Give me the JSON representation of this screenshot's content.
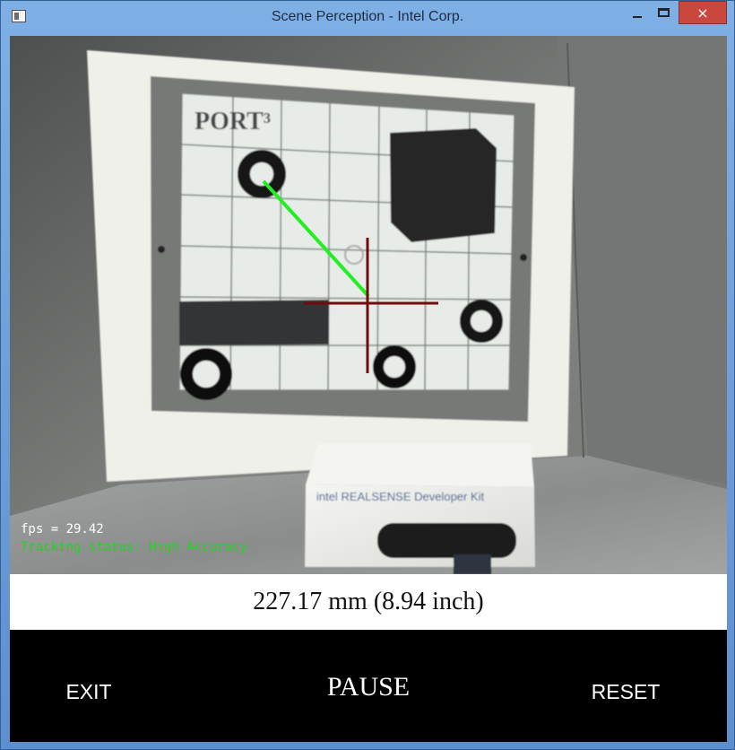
{
  "window": {
    "title": "Scene Perception - Intel Corp.",
    "icons": {
      "app": "app-window-icon",
      "minimize": "minimize-icon",
      "maximize": "maximize-icon",
      "close": "close-icon"
    },
    "close_label": "×"
  },
  "camera_view": {
    "fps_text": "fps = 29.42",
    "tracking_text": "Tracking status: High Accuracy",
    "target_text": "PORT³",
    "box_text": "intel REALSENSE Developer Kit",
    "colors": {
      "tracking_text": "#1fd51f",
      "measurement_line": "#22ef22",
      "crosshair": "#6f0c0c"
    }
  },
  "measurement": {
    "display": "227.17 mm (8.94 inch)"
  },
  "controls": {
    "exit_label": "EXIT",
    "pause_label": "PAUSE",
    "reset_label": "RESET"
  }
}
